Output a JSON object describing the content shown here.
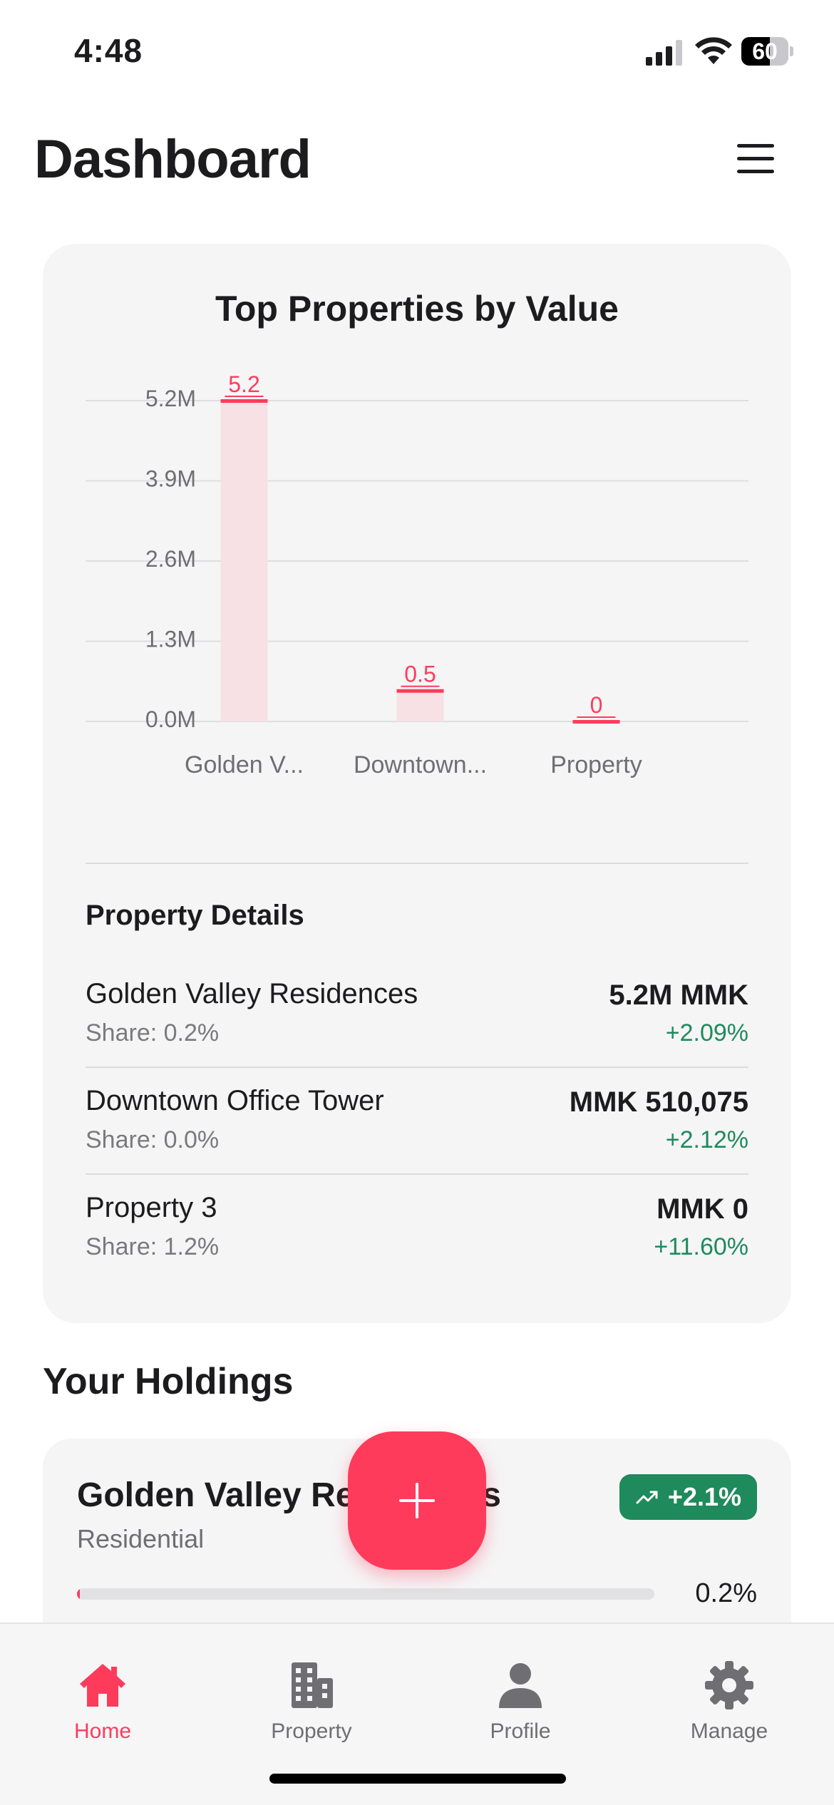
{
  "status_bar": {
    "time": "4:48",
    "battery": "60",
    "battery_level": 0.6
  },
  "header": {
    "title": "Dashboard"
  },
  "chart_card": {
    "title": "Top Properties by Value",
    "details_heading": "Property Details"
  },
  "chart_data": {
    "type": "bar",
    "title": "Top Properties by Value",
    "categories": [
      "Golden V...",
      "Downtown...",
      "Property"
    ],
    "values": [
      5.2,
      0.5,
      0
    ],
    "value_labels": [
      "5.2",
      "0.5",
      "0"
    ],
    "yticks": [
      "0.0M",
      "1.3M",
      "2.6M",
      "3.9M",
      "5.2M"
    ],
    "ytick_values": [
      0,
      1.3,
      2.6,
      3.9,
      5.2
    ],
    "ylim": [
      0,
      5.2
    ],
    "grid": true,
    "bar_color": "#ff3b5c",
    "bar_fill": "#f7e1e5"
  },
  "property_details": [
    {
      "name": "Golden Valley Residences",
      "share": "Share: 0.2%",
      "value": "5.2M MMK",
      "change": "+2.09%"
    },
    {
      "name": "Downtown Office Tower",
      "share": "Share: 0.0%",
      "value": "MMK 510,075",
      "change": "+2.12%"
    },
    {
      "name": "Property 3",
      "share": "Share: 1.2%",
      "value": "MMK 0",
      "change": "+11.60%"
    }
  ],
  "holdings": {
    "title": "Your Holdings",
    "items": [
      {
        "name": "Golden Valley Residences",
        "type": "Residential",
        "badge": "+2.1%",
        "share": "0.2%",
        "share_fraction": 0.002
      }
    ]
  },
  "fab": {
    "icon": "plus-icon"
  },
  "tab_bar": {
    "items": [
      {
        "label": "Home",
        "icon": "home-icon",
        "active": true
      },
      {
        "label": "Property",
        "icon": "building-icon",
        "active": false
      },
      {
        "label": "Profile",
        "icon": "person-icon",
        "active": false
      },
      {
        "label": "Manage",
        "icon": "gear-icon",
        "active": false
      }
    ]
  },
  "colors": {
    "accent": "#ff3b5c",
    "positive": "#1f8a5c",
    "card": "#f5f5f6"
  }
}
